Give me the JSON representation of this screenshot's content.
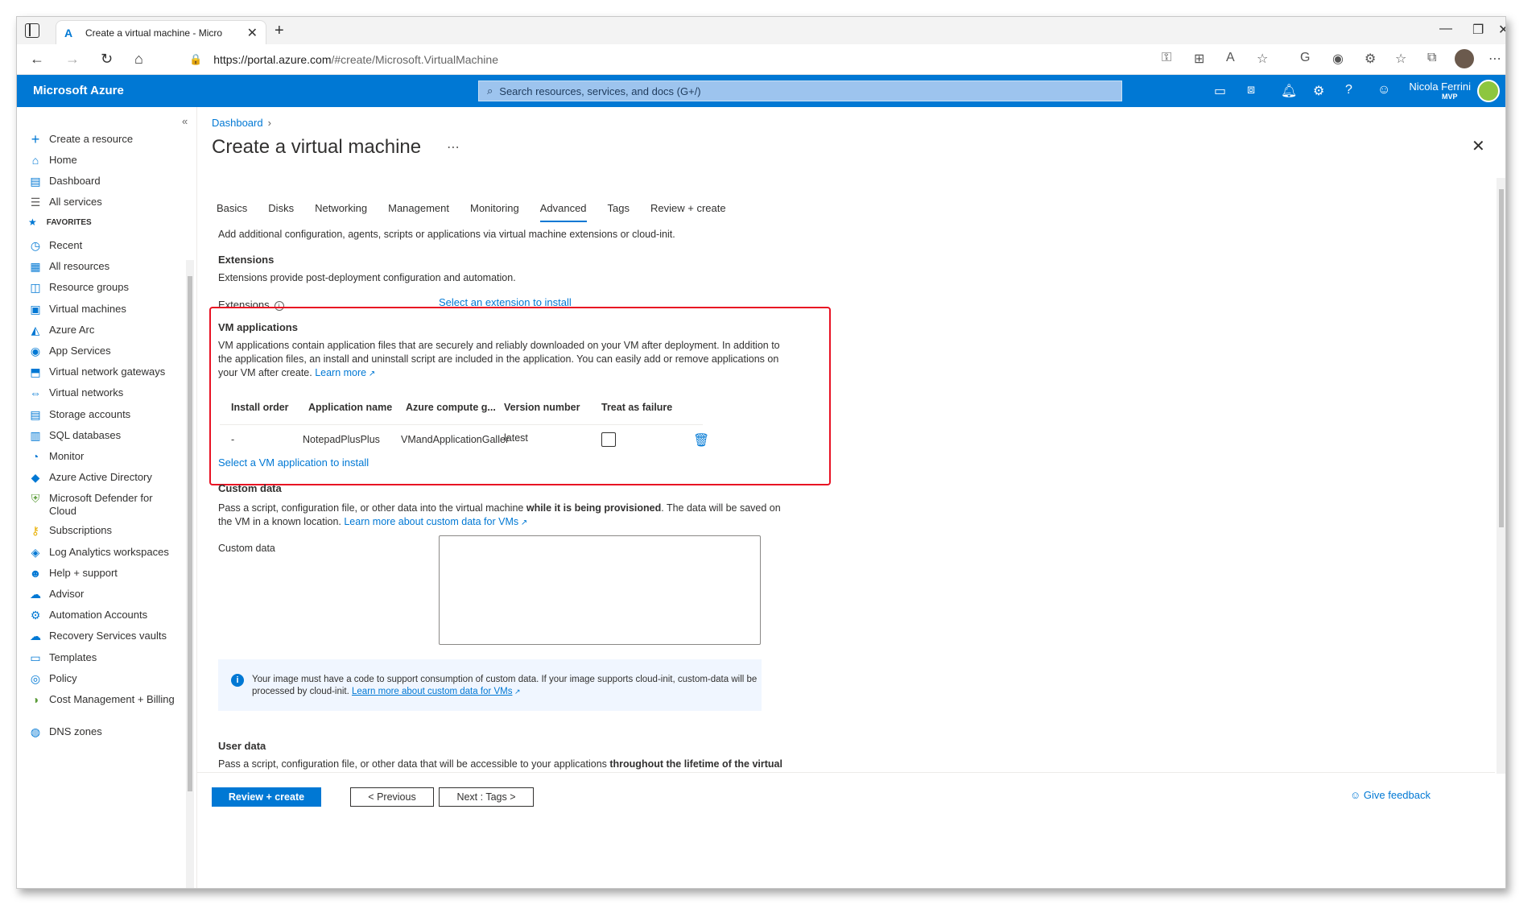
{
  "browser": {
    "tab_title": "Create a virtual machine - Micro",
    "url_host": "https://portal.azure.com",
    "url_path": "/#create/Microsoft.VirtualMachine"
  },
  "header": {
    "brand": "Microsoft Azure",
    "search_placeholder": "Search resources, services, and docs (G+/)",
    "user_name": "Nicola Ferrini",
    "user_badge": "MVP"
  },
  "sidebar": {
    "create": "Create a resource",
    "home": "Home",
    "dashboard": "Dashboard",
    "all_services": "All services",
    "favorites": "FAVORITES",
    "items": [
      {
        "label": "Recent",
        "icon": "clock-icon"
      },
      {
        "label": "All resources",
        "icon": "grid-icon"
      },
      {
        "label": "Resource groups",
        "icon": "resource-group-icon"
      },
      {
        "label": "Virtual machines",
        "icon": "monitor-icon"
      },
      {
        "label": "Azure Arc",
        "icon": "arc-icon"
      },
      {
        "label": "App Services",
        "icon": "globe-icon"
      },
      {
        "label": "Virtual network gateways",
        "icon": "lock-icon"
      },
      {
        "label": "Virtual networks",
        "icon": "network-icon"
      },
      {
        "label": "Storage accounts",
        "icon": "storage-icon"
      },
      {
        "label": "SQL databases",
        "icon": "sql-icon"
      },
      {
        "label": "Monitor",
        "icon": "gauge-icon"
      },
      {
        "label": "Azure Active Directory",
        "icon": "diamond-icon"
      },
      {
        "label": "Microsoft Defender for Cloud",
        "icon": "shield-icon"
      },
      {
        "label": "Subscriptions",
        "icon": "key-icon"
      },
      {
        "label": "Log Analytics workspaces",
        "icon": "analytics-icon"
      },
      {
        "label": "Help + support",
        "icon": "person-icon"
      },
      {
        "label": "Advisor",
        "icon": "cloud-icon"
      },
      {
        "label": "Automation Accounts",
        "icon": "gear-icon"
      },
      {
        "label": "Recovery Services vaults",
        "icon": "cloud-vault-icon"
      },
      {
        "label": "Templates",
        "icon": "template-icon"
      },
      {
        "label": "Policy",
        "icon": "policy-icon"
      },
      {
        "label": "Cost Management + Billing",
        "icon": "cost-icon"
      },
      {
        "label": "DNS zones",
        "icon": "dns-icon"
      }
    ]
  },
  "main": {
    "breadcrumb": "Dashboard",
    "title": "Create a virtual machine",
    "tabs": [
      "Basics",
      "Disks",
      "Networking",
      "Management",
      "Monitoring",
      "Advanced",
      "Tags",
      "Review + create"
    ],
    "active_tab": "Advanced",
    "intro": "Add additional configuration, agents, scripts or applications via virtual machine extensions or cloud-init.",
    "extensions_title": "Extensions",
    "extensions_desc": "Extensions provide post-deployment configuration and automation.",
    "extensions_label": "Extensions",
    "extensions_link": "Select an extension to install",
    "vm_apps_title": "VM applications",
    "vm_apps_desc_1": "VM applications contain application files that are securely and reliably downloaded on your VM after deployment. In addition to",
    "vm_apps_desc_2": "the application files, an install and uninstall script are included in the application. You can easily add or remove applications on",
    "vm_apps_desc_3": "your VM after create.",
    "vm_apps_learn": "Learn more",
    "table_headers": [
      "Install order",
      "Application name",
      "Azure compute g...",
      "Version number",
      "Treat as failure"
    ],
    "table_row": {
      "install_order": "-",
      "app_name": "NotepadPlusPlus",
      "gallery": "VMandApplicationGaller",
      "version": "latest"
    },
    "add_vm_app_link": "Select a VM application to install",
    "custom_data_title": "Custom data",
    "custom_data_desc_1a": "Pass a script, configuration file, or other data into the virtual machine ",
    "custom_data_desc_1b": "while it is being provisioned",
    "custom_data_desc_1c": ". The data will be saved on",
    "custom_data_desc_2": "the VM in a known location. ",
    "custom_data_learn": "Learn more about custom data for VMs",
    "custom_data_label": "Custom data",
    "info_text_1": "Your image must have a code to support consumption of custom data. If your image supports cloud-init, custom-data will be",
    "info_text_2": "processed by cloud-init. ",
    "info_link": "Learn more about custom data for VMs",
    "user_data_title": "User data",
    "user_data_desc_a": "Pass a script, configuration file, or other data that will be accessible to your applications ",
    "user_data_desc_b": "throughout the lifetime of the virtual"
  },
  "footer": {
    "review_create": "Review + create",
    "previous": "< Previous",
    "next": "Next : Tags >",
    "feedback": "Give feedback"
  },
  "colors": {
    "azure_blue": "#0078d4",
    "highlight_red": "#e81123"
  }
}
